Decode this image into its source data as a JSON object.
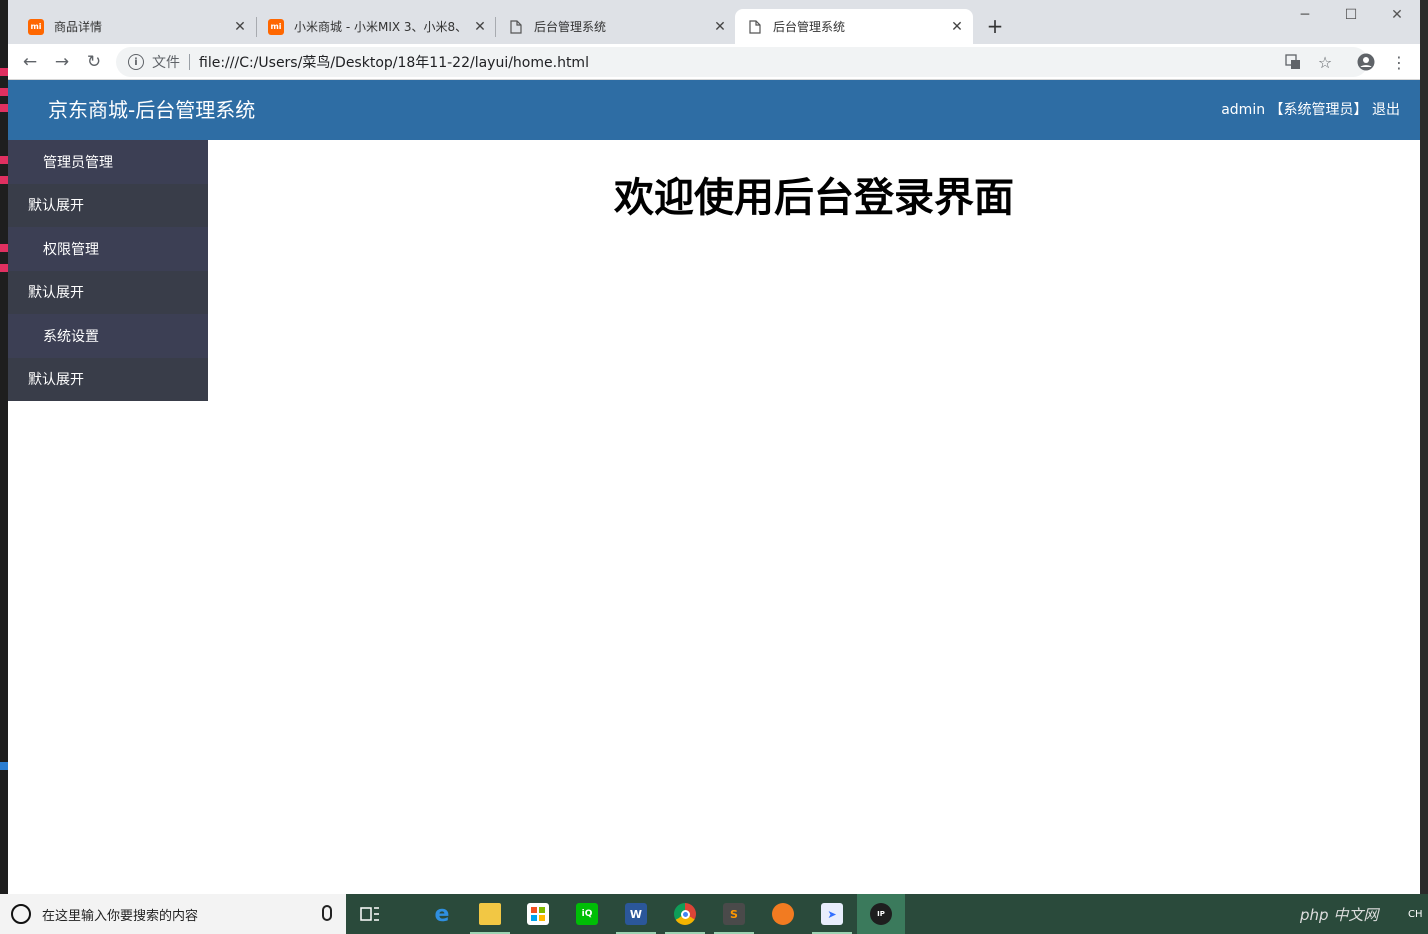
{
  "browser": {
    "tabs": [
      {
        "title": "商品详情",
        "favicon": "mi-logo-icon"
      },
      {
        "title": "小米商城 - 小米MIX 3、小米8、",
        "favicon": "mi-logo-icon"
      },
      {
        "title": "后台管理系统",
        "favicon": "page-icon"
      },
      {
        "title": "后台管理系统",
        "favicon": "page-icon",
        "active": true
      }
    ],
    "address": {
      "scheme_label": "文件",
      "url": "file:///C:/Users/菜鸟/Desktop/18年11-22/layui/home.html"
    }
  },
  "page": {
    "brand": "京东商城-后台管理系统",
    "user": {
      "name": "admin",
      "role": "【系统管理员】",
      "logout": "退出"
    },
    "sidebar": [
      {
        "group": "管理员管理",
        "child": "默认展开"
      },
      {
        "group": "权限管理",
        "child": "默认展开"
      },
      {
        "group": "系统设置",
        "child": "默认展开"
      }
    ],
    "heading": "欢迎使用后台登录界面"
  },
  "taskbar": {
    "search_placeholder": "在这里输入你要搜索的内容",
    "tray_lang": "CH",
    "watermark": "php 中文网"
  },
  "colors": {
    "header_bg": "#2e6da4",
    "sidebar_group_bg": "#3c3f54",
    "sidebar_child_bg": "#393d49",
    "taskbar_bg": "#2a4a3b"
  }
}
